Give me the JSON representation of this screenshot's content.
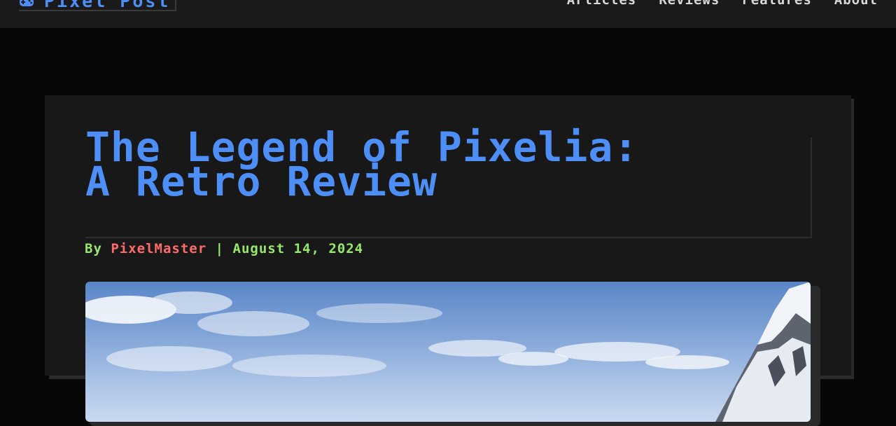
{
  "site": {
    "brand_name": "Pixel Post",
    "brand_icon": "gamepad-icon"
  },
  "nav": {
    "items": [
      {
        "label": "Articles"
      },
      {
        "label": "Reviews"
      },
      {
        "label": "Features"
      },
      {
        "label": "About"
      }
    ]
  },
  "article": {
    "title": "The Legend of Pixelia: A Retro Review",
    "byline_prefix": "By ",
    "author": "PixelMaster",
    "separator": " | ",
    "date": "August 14, 2024",
    "hero_image": "snowy-mountain-sky"
  },
  "colors": {
    "accent_blue": "#4d8ef7",
    "byline_green": "#97e86a",
    "author_red": "#ff6b6b",
    "nav_text": "#d8d8d8",
    "background": "#070707",
    "card": "#181818"
  }
}
